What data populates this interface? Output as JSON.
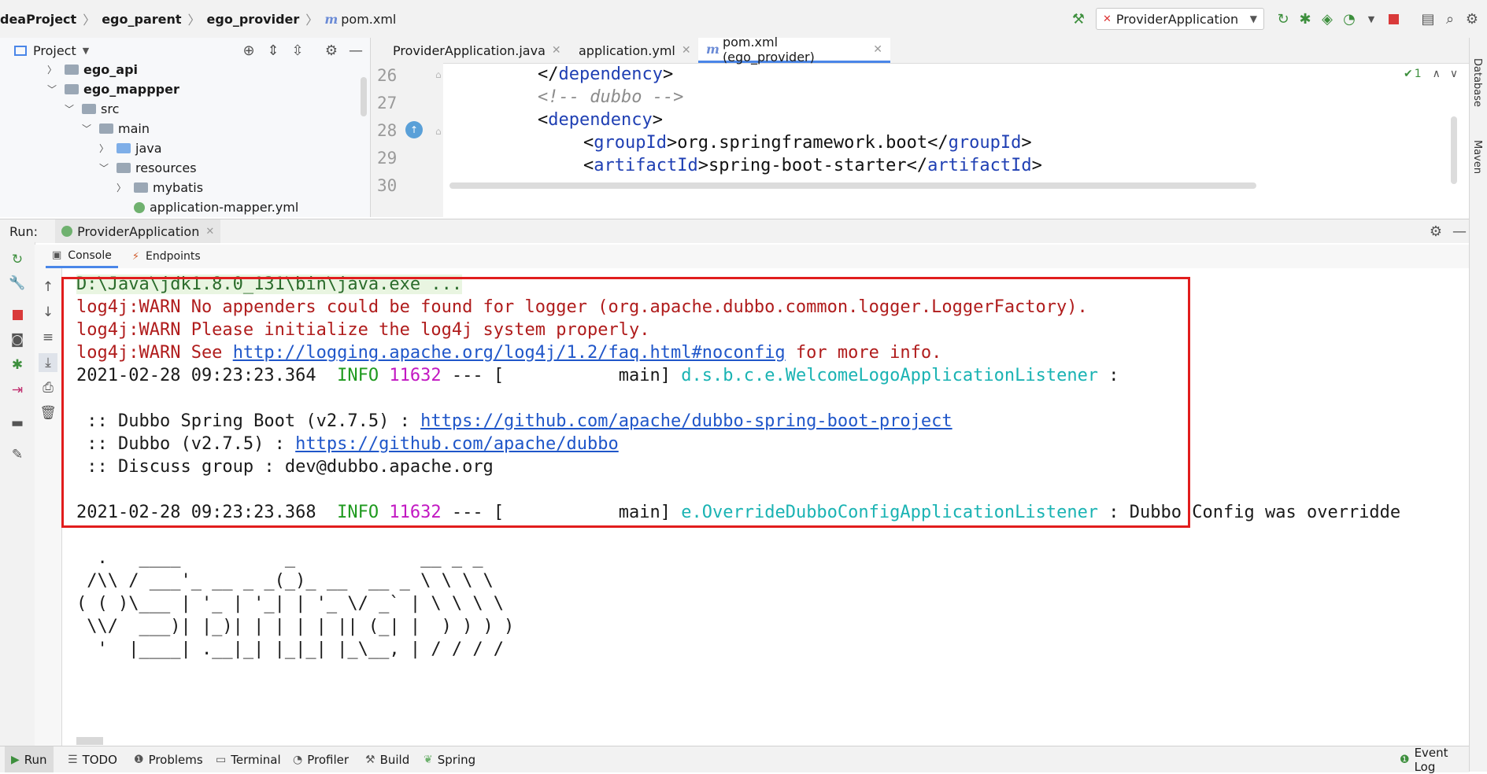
{
  "breadcrumb": {
    "items": [
      "deaProject",
      "ego_parent",
      "ego_provider"
    ],
    "file_icon": "m",
    "file": "pom.xml"
  },
  "run_config": {
    "label": "ProviderApplication"
  },
  "project_panel": {
    "title": "Project",
    "tree": [
      {
        "label": "ego_api",
        "bold": true
      },
      {
        "label": "ego_mappper",
        "bold": true
      },
      {
        "label": "src"
      },
      {
        "label": "main"
      },
      {
        "label": "java"
      },
      {
        "label": "resources"
      },
      {
        "label": "mybatis"
      },
      {
        "label": "application-mapper.yml"
      }
    ]
  },
  "editor": {
    "tabs": [
      {
        "label": "ProviderApplication.java"
      },
      {
        "label": "application.yml"
      },
      {
        "label": "pom.xml (ego_provider)"
      }
    ],
    "inspection_count": "1",
    "lines": [
      {
        "num": "26",
        "parts": [
          "</",
          "dependency",
          ">"
        ]
      },
      {
        "num": "27",
        "comment": "<!-- dubbo -->"
      },
      {
        "num": "28",
        "parts": [
          "<",
          "dependency",
          ">"
        ]
      },
      {
        "num": "29",
        "parts": [
          "<",
          "groupId",
          ">",
          "org.springframework.boot",
          "</",
          "groupId",
          ">"
        ]
      },
      {
        "num": "30",
        "parts": [
          "<",
          "artifactId",
          ">",
          "spring-boot-starter",
          "</",
          "artifactId",
          ">"
        ]
      }
    ]
  },
  "right_strip": {
    "database": "Database",
    "maven": "Maven"
  },
  "run_panel": {
    "label": "Run:",
    "config_tab": "ProviderApplication",
    "tabs": [
      "Console",
      "Endpoints"
    ]
  },
  "console": {
    "cmd": "D:\\Java\\jdk1.8.0_131\\bin\\java.exe ...",
    "warn1": "log4j:WARN No appenders could be found for logger (org.apache.dubbo.common.logger.LoggerFactory).",
    "warn2": "log4j:WARN Please initialize the log4j system properly.",
    "warn3_pre": "log4j:WARN See ",
    "warn3_link": "http://logging.apache.org/log4j/1.2/faq.html#noconfig",
    "warn3_post": " for more info.",
    "log1_ts": "2021-02-28 09:23:23.364",
    "log1_level": "INFO",
    "log1_pid": "11632",
    "log1_sep": " --- [           main] ",
    "log1_class": "d.s.b.c.e.WelcomeLogoApplicationListener",
    "log1_msg": " :",
    "dubbo1_pre": " :: Dubbo Spring Boot (v2.7.5) : ",
    "dubbo1_link": "https://github.com/apache/dubbo-spring-boot-project",
    "dubbo2_pre": " :: Dubbo (v2.7.5) : ",
    "dubbo2_link": "https://github.com/apache/dubbo",
    "dubbo3": " :: Discuss group : dev@dubbo.apache.org",
    "log2_ts": "2021-02-28 09:23:23.368",
    "log2_level": "INFO",
    "log2_pid": "11632",
    "log2_sep": " --- [           main] ",
    "log2_class": "e.OverrideDubboConfigApplicationListener",
    "log2_msg": " : Dubbo Config was overridde",
    "banner": [
      "  .   ____          _            __ _ _",
      " /\\\\ / ___'_ __ _ _(_)_ __  __ _ \\ \\ \\ \\",
      "( ( )\\___ | '_ | '_| | '_ \\/ _` | \\ \\ \\ \\",
      " \\\\/  ___)| |_)| | | | | || (_| |  ) ) ) )",
      "  '  |____| .__|_| |_|_| |_\\__, | / / / /"
    ]
  },
  "bottom_bar": {
    "items": [
      "Run",
      "TODO",
      "Problems",
      "Terminal",
      "Profiler",
      "Build",
      "Spring"
    ],
    "event_log": "Event Log"
  },
  "colors": {
    "highlight_box": "#e11d1d",
    "warn": "#b01c1c",
    "link": "#1f56c9",
    "info": "#1f9a1f",
    "pid": "#c218c2",
    "logger_class": "#1ab3b3",
    "xml_tag": "#1f3fb3"
  }
}
